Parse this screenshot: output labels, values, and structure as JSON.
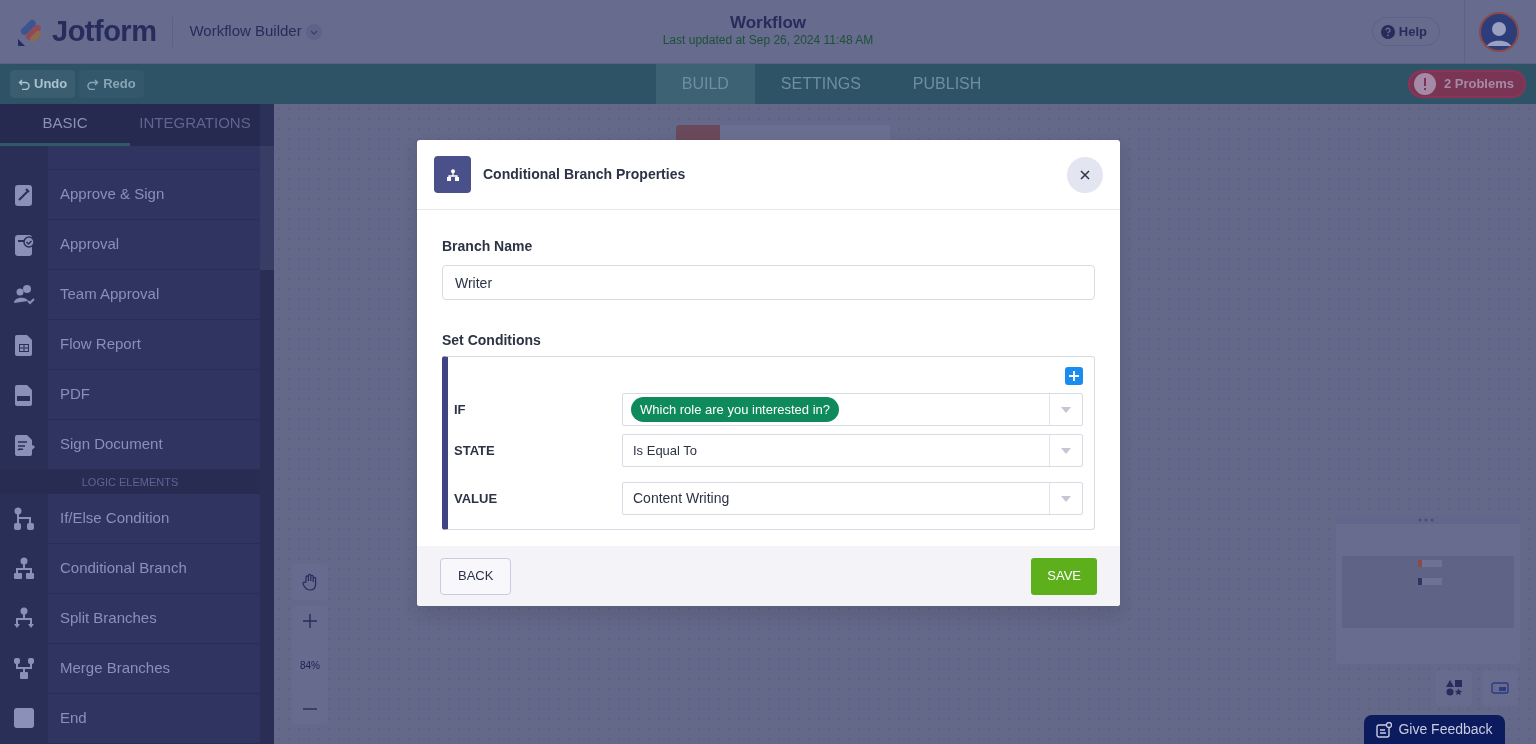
{
  "header": {
    "logo": "Jotform",
    "product": "Workflow Builder",
    "title": "Workflow",
    "subtitle": "Last updated at Sep 26, 2024 11:48 AM",
    "help": "Help"
  },
  "toolbar": {
    "undo": {
      "label": "Undo",
      "disabled": false
    },
    "redo": {
      "label": "Redo",
      "disabled": true
    },
    "tabs": [
      {
        "label": "BUILD",
        "selected": true
      },
      {
        "label": "SETTINGS",
        "selected": false
      },
      {
        "label": "PUBLISH",
        "selected": false
      }
    ],
    "problems": "2 Problems"
  },
  "sidebar": {
    "tabs": [
      {
        "label": "BASIC",
        "selected": true
      },
      {
        "label": "INTEGRATIONS",
        "selected": false
      }
    ],
    "items": [
      {
        "kind": "partial"
      },
      {
        "kind": "item",
        "label": "Approve & Sign"
      },
      {
        "kind": "item",
        "label": "Approval"
      },
      {
        "kind": "item",
        "label": "Team Approval"
      },
      {
        "kind": "item",
        "label": "Flow Report"
      },
      {
        "kind": "item",
        "label": "PDF"
      },
      {
        "kind": "item",
        "label": "Sign Document"
      },
      {
        "kind": "header",
        "label": "LOGIC ELEMENTS"
      },
      {
        "kind": "item",
        "label": "If/Else Condition"
      },
      {
        "kind": "item",
        "label": "Conditional Branch"
      },
      {
        "kind": "item",
        "label": "Split Branches"
      },
      {
        "kind": "item",
        "label": "Merge Branches"
      },
      {
        "kind": "item",
        "label": "End"
      }
    ]
  },
  "canvas": {
    "zoom": "84%",
    "feedback": "Give Feedback"
  },
  "modal": {
    "title": "Conditional Branch Properties",
    "branch_label": "Branch Name",
    "branch_value": "Writer",
    "conditions_label": "Set Conditions",
    "conditions": [
      {
        "label": "IF",
        "kind": "tag",
        "value": "Which role are you interested in?"
      },
      {
        "label": "STATE",
        "kind": "text",
        "value": "Is Equal To"
      },
      {
        "label": "VALUE",
        "kind": "text",
        "value": "Content Writing"
      }
    ],
    "back": "BACK",
    "save": "SAVE"
  }
}
